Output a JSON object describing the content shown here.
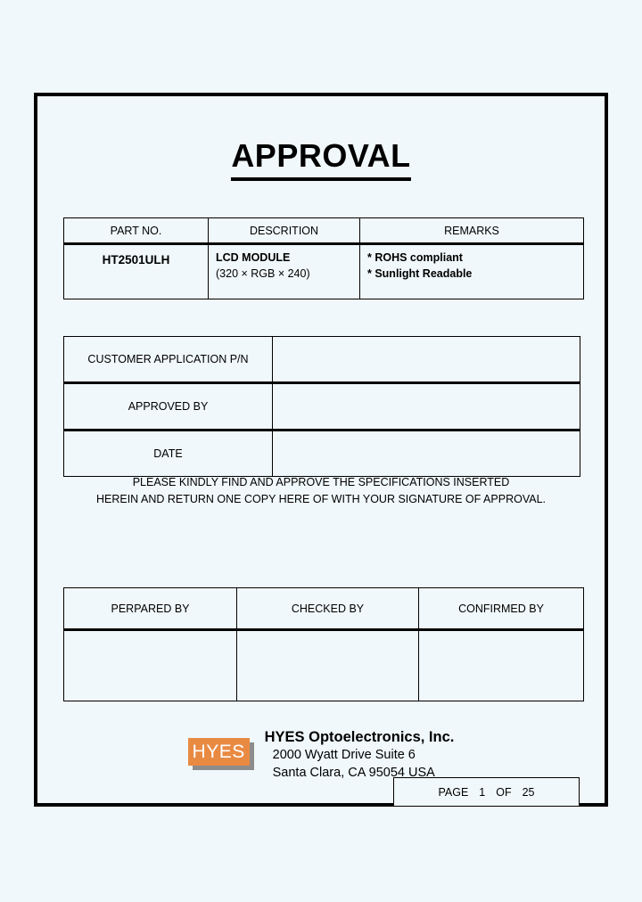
{
  "document": {
    "title": "APPROVAL"
  },
  "part_table": {
    "headers": [
      "PART NO.",
      "DESCRITION",
      "REMARKS"
    ],
    "row": {
      "part_no": "HT2501ULH",
      "description_title": "LCD MODULE",
      "description_sub": "(320 × RGB × 240)",
      "remarks": [
        "* ROHS compliant",
        "* Sunlight Readable"
      ]
    }
  },
  "customer_table": {
    "rows": [
      {
        "label": "CUSTOMER APPLICATION P/N",
        "value": ""
      },
      {
        "label": "APPROVED BY",
        "value": ""
      },
      {
        "label": "DATE",
        "value": ""
      }
    ]
  },
  "notice": {
    "line1": "PLEASE KINDLY FIND AND APPROVE THE SPECIFICATIONS INSERTED",
    "line2": "HEREIN AND RETURN ONE COPY HERE OF WITH YOUR SIGNATURE OF APPROVAL."
  },
  "signature_table": {
    "headers": [
      "PERPARED BY",
      "CHECKED BY",
      "CONFIRMED BY"
    ],
    "values": [
      "",
      "",
      ""
    ]
  },
  "footer": {
    "logo_text": "HYES",
    "company_name": "HYES Optoelectronics, Inc.",
    "address_line1": "2000 Wyatt Drive Suite 6",
    "address_line2": "Santa Clara, CA 95054 USA"
  },
  "page_number": {
    "label": "PAGE",
    "current": "1",
    "of_label": "OF",
    "total": "25"
  },
  "colors": {
    "background": "#f0f8fb",
    "border": "#000000",
    "logo_orange": "#e98a42",
    "logo_shadow": "#8c8c8c"
  }
}
